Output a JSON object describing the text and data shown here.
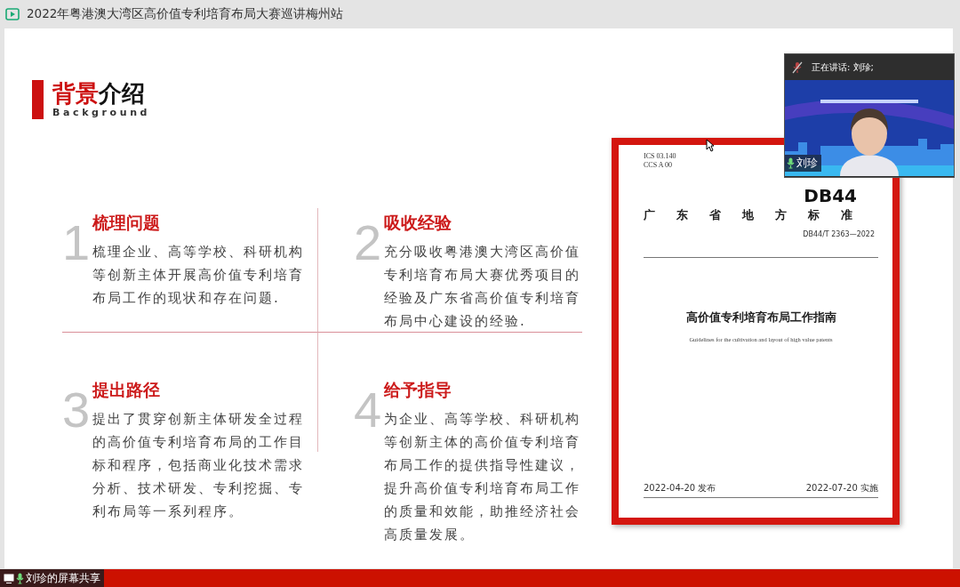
{
  "window": {
    "title": "2022年粤港澳大湾区高价值专利培育布局大赛巡讲梅州站"
  },
  "slide": {
    "heading": {
      "highlight": "背景",
      "rest": "介绍",
      "subtitle": "Background"
    },
    "sections": [
      {
        "number": "1",
        "title": "梳理问题",
        "text": "梳理企业、高等学校、科研机构等创新主体开展高价值专利培育布局工作的现状和存在问题."
      },
      {
        "number": "2",
        "title": "吸收经验",
        "text": "充分吸收粤港澳大湾区高价值专利培育布局大赛优秀项目的经验及广东省高价值专利培育布局中心建设的经验."
      },
      {
        "number": "3",
        "title": "提出路径",
        "text": "提出了贯穿创新主体研发全过程的高价值专利培育布局的工作目标和程序，包括商业化技术需求分析、技术研发、专利挖掘、专利布局等一系列程序。"
      },
      {
        "number": "4",
        "title": "给予指导",
        "text": "为企业、高等学校、科研机构等创新主体的高价值专利培育布局工作的提供指导性建议，提升高价值专利培育布局工作的质量和效能，助推经济社会高质量发展。"
      }
    ],
    "document": {
      "codes": [
        "ICS 03.140",
        "CCS A 00"
      ],
      "mark": "DB44",
      "category": "广东省地方标准",
      "standard_number": "DB44/T 2363—2022",
      "title": "高价值专利培育布局工作指南",
      "english_title": "Guidelines for the cultivation and layout of high value patents",
      "issued": "2022-04-20 发布",
      "effective": "2022-07-20 实施"
    }
  },
  "video": {
    "speaking": "正在讲话: 刘珍;",
    "name": "刘珍"
  },
  "status_bar": {
    "share_label": "刘珍的屏幕共享"
  }
}
